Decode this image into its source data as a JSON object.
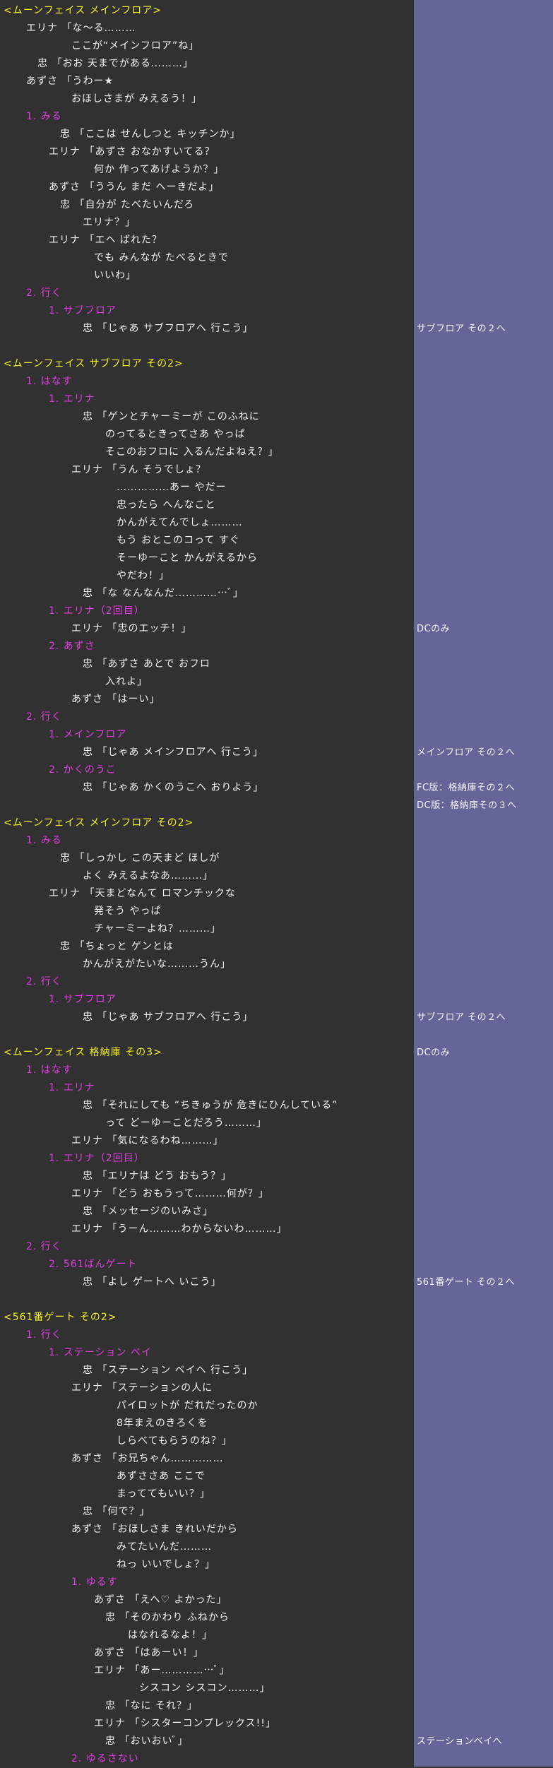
{
  "colors": {
    "background": "#313131",
    "side_column": "#666598",
    "heading": "#f2f224",
    "choice": "#e13ce0",
    "dialogue": "#f1f1ee",
    "note": "#f4f4f6"
  },
  "lines": [
    {
      "kind": "heading",
      "indent": 0,
      "text": "<ムーンフェイス メインフロア>"
    },
    {
      "kind": "dialogue",
      "indent": 2,
      "text": "エリナ 「な～る………"
    },
    {
      "kind": "dialogue",
      "indent": 6,
      "text": "ここが“メインフロア”ね」"
    },
    {
      "kind": "dialogue",
      "indent": 3,
      "text": "忠 「おお 天までがある………」"
    },
    {
      "kind": "dialogue",
      "indent": 2,
      "text": "あずさ 「うわー★"
    },
    {
      "kind": "dialogue",
      "indent": 6,
      "text": "おほしさまが みえるう！」"
    },
    {
      "kind": "choice",
      "indent": 2,
      "text": "1. みる"
    },
    {
      "kind": "dialogue",
      "indent": 5,
      "text": "忠 「ここは せんしつと キッチンか」"
    },
    {
      "kind": "dialogue",
      "indent": 4,
      "text": "エリナ 「あずさ おなかすいてる？"
    },
    {
      "kind": "dialogue",
      "indent": 8,
      "text": "何か 作ってあげようか？」"
    },
    {
      "kind": "dialogue",
      "indent": 4,
      "text": "あずさ 「ううん まだ へーきだよ」"
    },
    {
      "kind": "dialogue",
      "indent": 5,
      "text": "忠 「自分が たべたいんだろ"
    },
    {
      "kind": "dialogue",
      "indent": 7,
      "text": "エリナ？」"
    },
    {
      "kind": "dialogue",
      "indent": 4,
      "text": "エリナ 「エヘ ばれた？"
    },
    {
      "kind": "dialogue",
      "indent": 8,
      "text": "でも みんなが たべるときで"
    },
    {
      "kind": "dialogue",
      "indent": 8,
      "text": "いいわ」"
    },
    {
      "kind": "choice",
      "indent": 2,
      "text": "2. 行く"
    },
    {
      "kind": "choice",
      "indent": 4,
      "text": "1. サブフロア"
    },
    {
      "kind": "dialogue",
      "indent": 7,
      "text": "忠 「じゃあ サブフロアへ 行こう」",
      "note": "サブフロア その２へ"
    },
    {
      "kind": "blank",
      "indent": 0,
      "text": ""
    },
    {
      "kind": "heading",
      "indent": 0,
      "text": "<ムーンフェイス サブフロア その2>"
    },
    {
      "kind": "choice",
      "indent": 2,
      "text": "1. はなす"
    },
    {
      "kind": "choice",
      "indent": 4,
      "text": "1. エリナ"
    },
    {
      "kind": "dialogue",
      "indent": 7,
      "text": "忠 「ゲンとチャーミーが このふねに"
    },
    {
      "kind": "dialogue",
      "indent": 9,
      "text": "のってるときってさあ やっぱ"
    },
    {
      "kind": "dialogue",
      "indent": 9,
      "text": "そこのおフロに 入るんだよねえ？」"
    },
    {
      "kind": "dialogue",
      "indent": 6,
      "text": "エリナ 「うん そうでしょ？"
    },
    {
      "kind": "dialogue",
      "indent": 10,
      "text": "……………あー やだー"
    },
    {
      "kind": "dialogue",
      "indent": 10,
      "text": "忠ったら へんなこと"
    },
    {
      "kind": "dialogue",
      "indent": 10,
      "text": "かんがえてんでしょ………"
    },
    {
      "kind": "dialogue",
      "indent": 10,
      "text": "もう おとこのコって すぐ"
    },
    {
      "kind": "dialogue",
      "indent": 10,
      "text": "そーゆーこと かんがえるから"
    },
    {
      "kind": "dialogue",
      "indent": 10,
      "text": "やだわ！」"
    },
    {
      "kind": "dialogue",
      "indent": 7,
      "text": "忠 「な なんなんだ……………ﾞ」"
    },
    {
      "kind": "choice",
      "indent": 4,
      "text": "1. エリナ（2回目）"
    },
    {
      "kind": "dialogue",
      "indent": 6,
      "text": "エリナ 「忠のエッチ！」",
      "note": "DCのみ"
    },
    {
      "kind": "choice",
      "indent": 4,
      "text": "2. あずさ"
    },
    {
      "kind": "dialogue",
      "indent": 7,
      "text": "忠 「あずさ あとで おフロ"
    },
    {
      "kind": "dialogue",
      "indent": 9,
      "text": "入れよ」"
    },
    {
      "kind": "dialogue",
      "indent": 6,
      "text": "あずさ 「はーい」"
    },
    {
      "kind": "choice",
      "indent": 2,
      "text": "2. 行く"
    },
    {
      "kind": "choice",
      "indent": 4,
      "text": "1. メインフロア"
    },
    {
      "kind": "dialogue",
      "indent": 7,
      "text": "忠 「じゃあ メインフロアへ 行こう」",
      "note": "メインフロア その２へ"
    },
    {
      "kind": "choice",
      "indent": 4,
      "text": "2. かくのうこ"
    },
    {
      "kind": "dialogue",
      "indent": 7,
      "text": "忠 「じゃあ かくのうこへ おりよう」",
      "note": "FC版：格納庫その２へ"
    },
    {
      "kind": "blank",
      "indent": 0,
      "text": "",
      "note": "DC版：格納庫その３へ"
    },
    {
      "kind": "heading",
      "indent": 0,
      "text": "<ムーンフェイス メインフロア その2>"
    },
    {
      "kind": "choice",
      "indent": 2,
      "text": "1. みる"
    },
    {
      "kind": "dialogue",
      "indent": 5,
      "text": "忠 「しっかし この天まど ほしが"
    },
    {
      "kind": "dialogue",
      "indent": 7,
      "text": "よく みえるよなあ………」"
    },
    {
      "kind": "dialogue",
      "indent": 4,
      "text": "エリナ 「天まどなんて ロマンチックな"
    },
    {
      "kind": "dialogue",
      "indent": 8,
      "text": "発そう やっぱ"
    },
    {
      "kind": "dialogue",
      "indent": 8,
      "text": "チャーミーよね？………」"
    },
    {
      "kind": "dialogue",
      "indent": 5,
      "text": "忠 「ちょっと ゲンとは"
    },
    {
      "kind": "dialogue",
      "indent": 7,
      "text": "かんがえがたいな………うん」"
    },
    {
      "kind": "choice",
      "indent": 2,
      "text": "2. 行く"
    },
    {
      "kind": "choice",
      "indent": 4,
      "text": "1. サブフロア"
    },
    {
      "kind": "dialogue",
      "indent": 7,
      "text": "忠 「じゃあ サブフロアへ 行こう」",
      "note": "サブフロア その２へ"
    },
    {
      "kind": "blank",
      "indent": 0,
      "text": ""
    },
    {
      "kind": "heading",
      "indent": 0,
      "text": "<ムーンフェイス 格納庫 その3>",
      "note": "DCのみ"
    },
    {
      "kind": "choice",
      "indent": 2,
      "text": "1. はなす"
    },
    {
      "kind": "choice",
      "indent": 4,
      "text": "1. エリナ"
    },
    {
      "kind": "dialogue",
      "indent": 7,
      "text": "忠 「それにしても “ちきゅうが 危きにひんしている”"
    },
    {
      "kind": "dialogue",
      "indent": 9,
      "text": "って どーゆーことだろう………」"
    },
    {
      "kind": "dialogue",
      "indent": 6,
      "text": "エリナ 「気になるわね………」"
    },
    {
      "kind": "choice",
      "indent": 4,
      "text": "1. エリナ（2回目）"
    },
    {
      "kind": "dialogue",
      "indent": 7,
      "text": "忠 「エリナは どう おもう？」"
    },
    {
      "kind": "dialogue",
      "indent": 6,
      "text": "エリナ 「どう おもうって………何が？」"
    },
    {
      "kind": "dialogue",
      "indent": 7,
      "text": "忠 「メッセージのいみさ」"
    },
    {
      "kind": "dialogue",
      "indent": 6,
      "text": "エリナ 「うーん………わからないわ………」"
    },
    {
      "kind": "choice",
      "indent": 2,
      "text": "2. 行く"
    },
    {
      "kind": "choice",
      "indent": 4,
      "text": "2. 561ばんゲート"
    },
    {
      "kind": "dialogue",
      "indent": 7,
      "text": "忠 「よし ゲートへ いこう」",
      "note": "561番ゲート その２へ"
    },
    {
      "kind": "blank",
      "indent": 0,
      "text": ""
    },
    {
      "kind": "heading",
      "indent": 0,
      "text": "<561番ゲート その2>"
    },
    {
      "kind": "choice",
      "indent": 2,
      "text": "1. 行く"
    },
    {
      "kind": "choice",
      "indent": 4,
      "text": "1. ステーション ベイ"
    },
    {
      "kind": "dialogue",
      "indent": 7,
      "text": "忠 「ステーション ベイへ 行こう」"
    },
    {
      "kind": "dialogue",
      "indent": 6,
      "text": "エリナ 「ステーションの人に"
    },
    {
      "kind": "dialogue",
      "indent": 10,
      "text": "パイロットが だれだったのか"
    },
    {
      "kind": "dialogue",
      "indent": 10,
      "text": "8年まえのきろくを"
    },
    {
      "kind": "dialogue",
      "indent": 10,
      "text": "しらべてもらうのね？」"
    },
    {
      "kind": "dialogue",
      "indent": 6,
      "text": "あずさ 「お兄ちゃん……………"
    },
    {
      "kind": "dialogue",
      "indent": 10,
      "text": "あずささあ ここで"
    },
    {
      "kind": "dialogue",
      "indent": 10,
      "text": "まっててもいい？」"
    },
    {
      "kind": "dialogue",
      "indent": 7,
      "text": "忠 「何で？」"
    },
    {
      "kind": "dialogue",
      "indent": 6,
      "text": "あずさ 「おほしさま きれいだから"
    },
    {
      "kind": "dialogue",
      "indent": 10,
      "text": "みてたいんだ………"
    },
    {
      "kind": "dialogue",
      "indent": 10,
      "text": "ねっ いいでしょ？」"
    },
    {
      "kind": "choice",
      "indent": 6,
      "text": "1. ゆるす"
    },
    {
      "kind": "dialogue",
      "indent": 8,
      "text": "あずさ 「えへ♡ よかった」"
    },
    {
      "kind": "dialogue",
      "indent": 9,
      "text": "忠 「そのかわり ふねから"
    },
    {
      "kind": "dialogue",
      "indent": 11,
      "text": "はなれるなよ！」"
    },
    {
      "kind": "dialogue",
      "indent": 8,
      "text": "あずさ 「はあーい！」"
    },
    {
      "kind": "dialogue",
      "indent": 8,
      "text": "エリナ 「あー……………ﾞ」"
    },
    {
      "kind": "dialogue",
      "indent": 12,
      "text": "シスコン シスコン………」"
    },
    {
      "kind": "dialogue",
      "indent": 9,
      "text": "忠 「なに それ？」"
    },
    {
      "kind": "dialogue",
      "indent": 8,
      "text": "エリナ 「シスターコンプレックス!!」"
    },
    {
      "kind": "dialogue",
      "indent": 9,
      "text": "忠 「おいおいﾞ」",
      "note": "ステーションベイへ"
    },
    {
      "kind": "choice",
      "indent": 6,
      "text": "2. ゆるさない"
    }
  ]
}
